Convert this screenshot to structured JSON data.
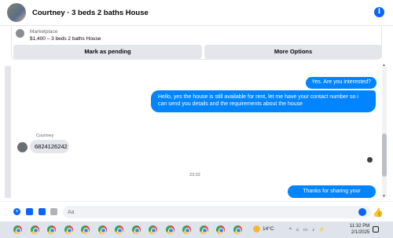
{
  "header": {
    "title": "Courtney · 3 beds 2 baths House",
    "info_icon": "i"
  },
  "marketplace": {
    "source": "Marketplace",
    "listing": "$1,400 – 3 beds 2 baths House",
    "pending_label": "Mark as pending",
    "more_label": "More Options"
  },
  "messages": {
    "out1": "Yes. Are you interested?",
    "out2": "Hello, yes the house is still available for rent, let me have your contact number so i can send you details and the requirements about the house",
    "sender": "Courtney",
    "in1": "6824126242",
    "time": "23:32",
    "out3": "Thanks for sharing your number"
  },
  "composer": {
    "placeholder": "Aa"
  },
  "taskbar": {
    "weather": "14°C",
    "clock_time": "11:32 PM",
    "clock_date": "2/1/2025",
    "tray": "^ ⌂ ▭ ♪ ⚡",
    "app_icon": "chrome-icon",
    "app_count": 14
  },
  "colors": {
    "accent": "#0084ff",
    "incoming": "#e4e6eb"
  }
}
